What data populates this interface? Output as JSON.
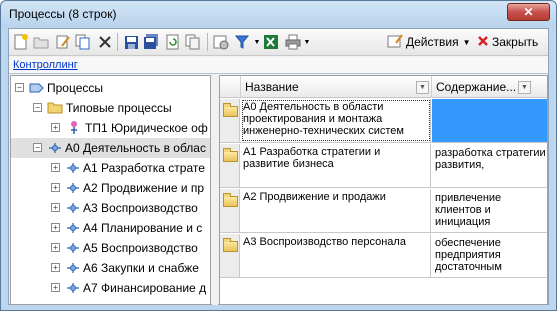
{
  "window": {
    "title": "Процессы (8 строк)",
    "close_glyph": "✕"
  },
  "toolbar": {
    "actions_label": "Действия",
    "close_label": "Закрыть",
    "icons": [
      "new-icon",
      "folder-new-icon",
      "edit-icon",
      "copy-icon",
      "delete-icon",
      "save-icon",
      "save-all-icon",
      "refresh-icon",
      "duplicate-icon",
      "settings-icon",
      "filter-icon",
      "excel-icon",
      "print-icon"
    ]
  },
  "breadcrumb": {
    "link": "Контроллинг"
  },
  "tree": {
    "items": [
      {
        "label": "Процессы"
      },
      {
        "label": "Типовые процессы"
      },
      {
        "label": "ТП1 Юридическое оф"
      },
      {
        "label": "А0 Деятельность в облас"
      },
      {
        "label": "А1 Разработка страте"
      },
      {
        "label": "А2 Продвижение и пр"
      },
      {
        "label": "А3 Воспроизводство"
      },
      {
        "label": "А4 Планирование и с"
      },
      {
        "label": "А5 Воспроизводство"
      },
      {
        "label": "А6 Закупки и снабже"
      },
      {
        "label": "А7 Финансирование д"
      }
    ]
  },
  "grid": {
    "columns": [
      "Название",
      "Содержание..."
    ],
    "rows": [
      {
        "name": "А0 Деятельность в области проектирования и монтажа инженерно-технических систем",
        "content": ""
      },
      {
        "name": "А1 Разработка стратегии и развитие бизнеса",
        "content": "разработка стратегии развития,"
      },
      {
        "name": "А2 Продвижение и продажи",
        "content": "привлечение клиентов и инициация"
      },
      {
        "name": "А3 Воспроизводство персонала",
        "content": "обеспечение предприятия достаточным"
      }
    ]
  },
  "colors": {
    "selection": "#3399ff",
    "link": "#0033cc",
    "window_frame": "#bcd6ee"
  }
}
